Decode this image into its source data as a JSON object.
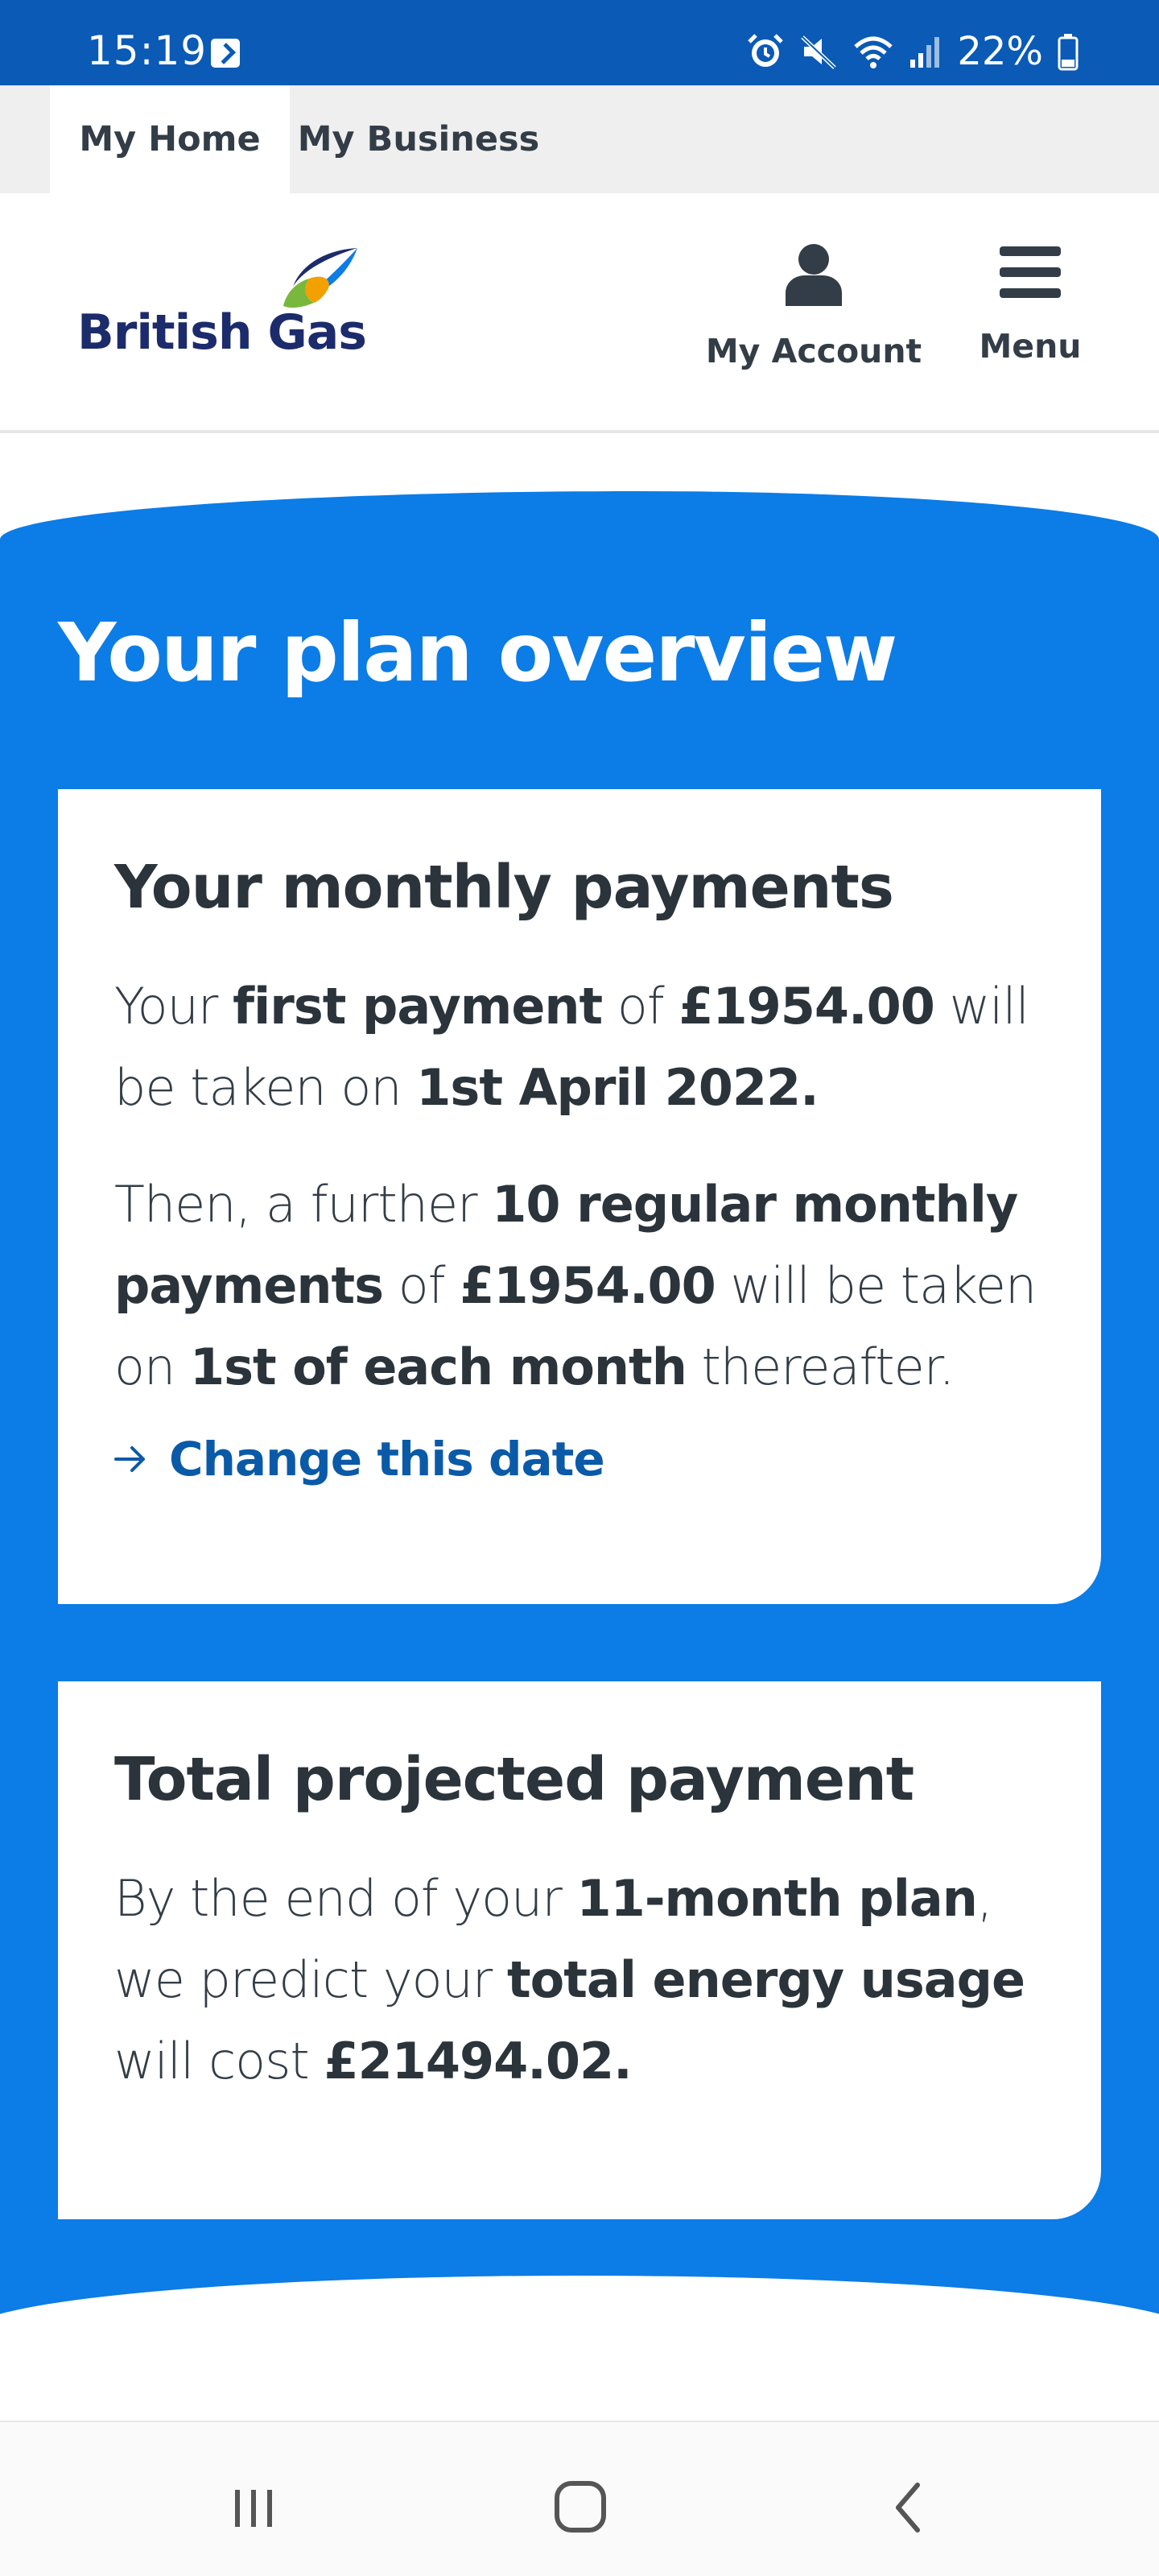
{
  "status_bar": {
    "time": "15:19",
    "battery": "22%",
    "icons": [
      "app-notification-icon",
      "alarm-icon",
      "mute-icon",
      "wifi-icon",
      "signal-icon",
      "battery-icon"
    ]
  },
  "tabs": [
    {
      "label": "My Home",
      "active": true
    },
    {
      "label": "My Business",
      "active": false
    }
  ],
  "header": {
    "logo_text": "British Gas",
    "account_label": "My Account",
    "menu_label": "Menu"
  },
  "hero": {
    "title": "Your plan overview"
  },
  "monthly_payments": {
    "heading": "Your monthly payments",
    "p1": [
      "Your ",
      "first payment",
      " of ",
      "£1954.00",
      " will be taken on ",
      "1st April 2022."
    ],
    "p2": [
      "Then, a further ",
      "10 regular monthly payments",
      " of ",
      "£1954.00",
      " will be taken on ",
      "1st of each month",
      " thereafter."
    ],
    "change_link": "Change this date"
  },
  "total_payment": {
    "heading": "Total projected payment",
    "p1": [
      "By the end of your ",
      "11-month plan",
      ", we predict your ",
      "total energy usage",
      " will cost ",
      "£21494.02."
    ]
  },
  "colors": {
    "status_bar": "#0a5ab6",
    "hero_blue": "#0c7ce6",
    "link_blue": "#0a5aa8",
    "logo_navy": "#1c2b6b"
  },
  "nav": [
    "recent-apps-icon",
    "home-icon",
    "back-icon"
  ]
}
